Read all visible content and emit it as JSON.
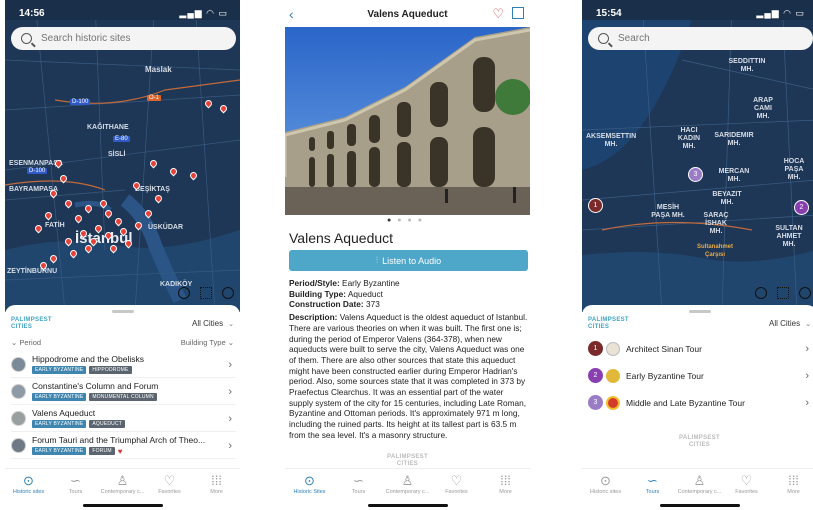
{
  "screen1": {
    "status_time": "14:56",
    "status_right": "▂▄▆ ◠ ▭",
    "search_placeholder": "Search historic sites",
    "map_labels": [
      "Maslak",
      "KAĞITHANE",
      "SİSLİ",
      "ESENMANPAŞA",
      "BAYRAMPAŞA",
      "BEŞİKTAŞ",
      "FATİH",
      "İstanbul",
      "ÜSKÜDAR",
      "ZEYTİNBURNU",
      "KADIKÖY"
    ],
    "road_badges": [
      "D-100",
      "O-1",
      "E-80",
      "D-100"
    ],
    "brand": "PALIMPSEST\nCITIES",
    "city_filter": "All Cities",
    "filter_period": "Period",
    "filter_building": "Building Type",
    "sites": [
      {
        "title": "Hippodrome and the Obelisks",
        "tags": [
          "EARLY BYZANTINE",
          "HIPPODROME"
        ]
      },
      {
        "title": "Constantine's Column and Forum",
        "tags": [
          "EARLY BYZANTINE",
          "MONUMENTAL COLUMN"
        ]
      },
      {
        "title": "Valens Aqueduct",
        "tags": [
          "EARLY BYZANTINE",
          "AQUEDUCT"
        ]
      },
      {
        "title": "Forum Tauri and the Triumphal Arch of Theo...",
        "tags": [
          "EARLY BYZANTINE",
          "FORUM"
        ]
      }
    ]
  },
  "tabs": [
    {
      "label": "Historic sites",
      "icon": "pin-icon"
    },
    {
      "label": "Tours",
      "icon": "route-icon"
    },
    {
      "label": "Contemporary c...",
      "icon": "person-icon"
    },
    {
      "label": "Favorites",
      "icon": "heart-icon"
    },
    {
      "label": "More",
      "icon": "grid-icon"
    }
  ],
  "tabs_s2": [
    {
      "label": "Historic Sites"
    },
    {
      "label": "Tours"
    },
    {
      "label": "Contemporary c..."
    },
    {
      "label": "Favorites"
    },
    {
      "label": "More"
    }
  ],
  "screen2": {
    "title": "Valens Aqueduct",
    "name": "Valens Aqueduct",
    "audio_label": "Listen to Audio",
    "period_label": "Period/Style:",
    "period_value": "Early Byzantine",
    "type_label": "Building Type:",
    "type_value": "Aqueduct",
    "date_label": "Construction Date:",
    "date_value": "373",
    "desc_label": "Description:",
    "desc_value": "Valens Aqueduct is the oldest aqueduct of Istanbul. There are various theories on when it was built. The first one is; during the period of Emperor Valens (364-378), when new aqueducts were built to serve the city, Valens Aqueduct was one of them. There are also other sources that state this aqueduct might have been constructed earlier during Emperor Hadrian's period. Also, some sources state that it was completed in 373 by Praefectus Clearchus. It was an essential part of the water supply system of the city for 15 centuries, including Late Roman, Byzantine and Ottoman periods. It's approximately 971 m long, including the ruined parts. Its height at its tallest part is 63.5 m from the sea level. It's a masonry structure.",
    "brand": "PALIMPSEST\nCITIES"
  },
  "screen3": {
    "status_time": "15:54",
    "status_right": "▂▄▆ ◠ ▭",
    "search_placeholder": "Search",
    "map_labels": [
      "SEDDITTIN MH.",
      "ARAP CAMI MH.",
      "AKSEMSETTIN MH.",
      "HACI KADIN MH.",
      "SARIDEMIR MH.",
      "HOCA PAŞA MH.",
      "MERCAN MH.",
      "BEYAZIT MH.",
      "MESİH PAŞA MH.",
      "SARAÇ İSHAK MH.",
      "SULTAN AHMET MH.",
      "Sultanahmet Çarşısı"
    ],
    "markers": [
      "1",
      "2",
      "3"
    ],
    "brand": "PALIMPSEST\nCITIES",
    "city_filter": "All Cities",
    "tours": [
      {
        "num": "1",
        "name": "Architect Sinan Tour",
        "color": "#7a2a2a"
      },
      {
        "num": "2",
        "name": "Early Byzantine Tour",
        "color": "#8a3fb0"
      },
      {
        "num": "3",
        "name": "Middle and Late Byzantine Tour",
        "color": "#9a7cc6"
      }
    ]
  }
}
